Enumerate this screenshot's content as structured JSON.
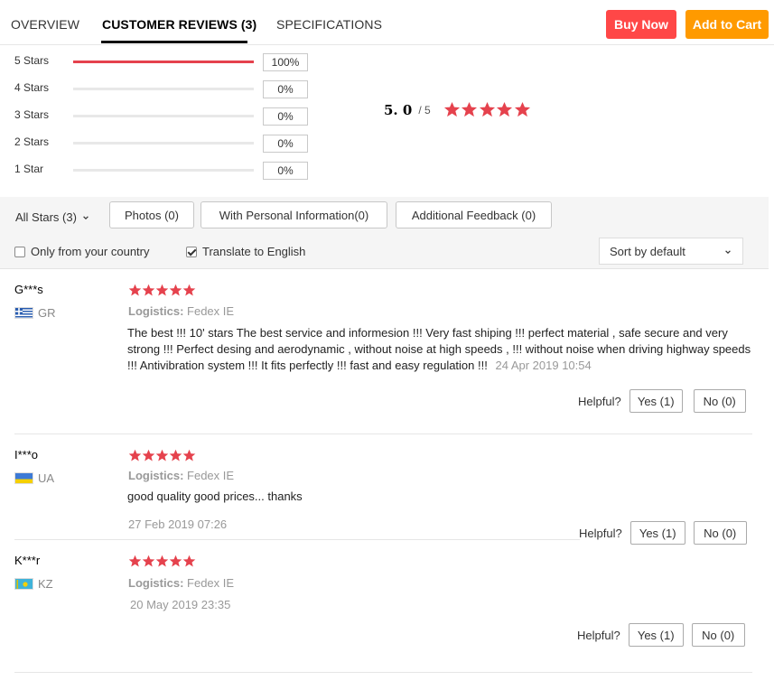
{
  "tabs": [
    {
      "label": "OVERVIEW"
    },
    {
      "label": "CUSTOMER REVIEWS (3)"
    },
    {
      "label": "SPECIFICATIONS"
    }
  ],
  "actions": {
    "buy_now": "Buy Now",
    "add_to_cart": "Add to Cart"
  },
  "histogram": [
    {
      "label": "5 Stars",
      "percent": "100%",
      "fill": 1.0
    },
    {
      "label": "4 Stars",
      "percent": "0%",
      "fill": 0
    },
    {
      "label": "3 Stars",
      "percent": "0%",
      "fill": 0
    },
    {
      "label": "2 Stars",
      "percent": "0%",
      "fill": 0
    },
    {
      "label": "1 Star",
      "percent": "0%",
      "fill": 0
    }
  ],
  "average": {
    "value": "5. 0",
    "out_of": "/ 5",
    "stars": 5
  },
  "filters": {
    "all_stars": "All Stars (3)",
    "photos": "Photos (0)",
    "personal": "With Personal Information(0)",
    "additional": "Additional Feedback (0)",
    "only_country": "Only from your country",
    "translate": "Translate to English",
    "sort": "Sort by default"
  },
  "reviews": [
    {
      "user": "G***s",
      "country": "GR",
      "stars": 5,
      "logistics_label": "Logistics:",
      "logistics_value": "Fedex IE",
      "text": "The best !!! 10' stars The best service and informesion !!! Very fast shiping !!! perfect material , safe secure and very strong !!! Perfect desing and aerodynamic , without noise at high speeds , !!! without noise when driving highway speeds !!! Antivibration system !!! It fits perfectly !!! fast and easy regulation !!!",
      "date": "24 Apr 2019 10:54",
      "helpful": "Helpful?",
      "yes": "Yes (1)",
      "no": "No (0)"
    },
    {
      "user": "I***o",
      "country": "UA",
      "stars": 5,
      "logistics_label": "Logistics:",
      "logistics_value": "Fedex IE",
      "text": "good quality good prices... thanks",
      "date": "27 Feb 2019 07:26",
      "helpful": "Helpful?",
      "yes": "Yes (1)",
      "no": "No (0)"
    },
    {
      "user": "K***r",
      "country": "KZ",
      "stars": 5,
      "logistics_label": "Logistics:",
      "logistics_value": "Fedex IE",
      "text": "",
      "date": "20 May 2019 23:35",
      "helpful": "Helpful?",
      "yes": "Yes (1)",
      "no": "No (0)"
    }
  ],
  "colors": {
    "accent_red": "#ff4747",
    "cart_orange": "#ff9a00",
    "star_red": "#e5424d"
  }
}
